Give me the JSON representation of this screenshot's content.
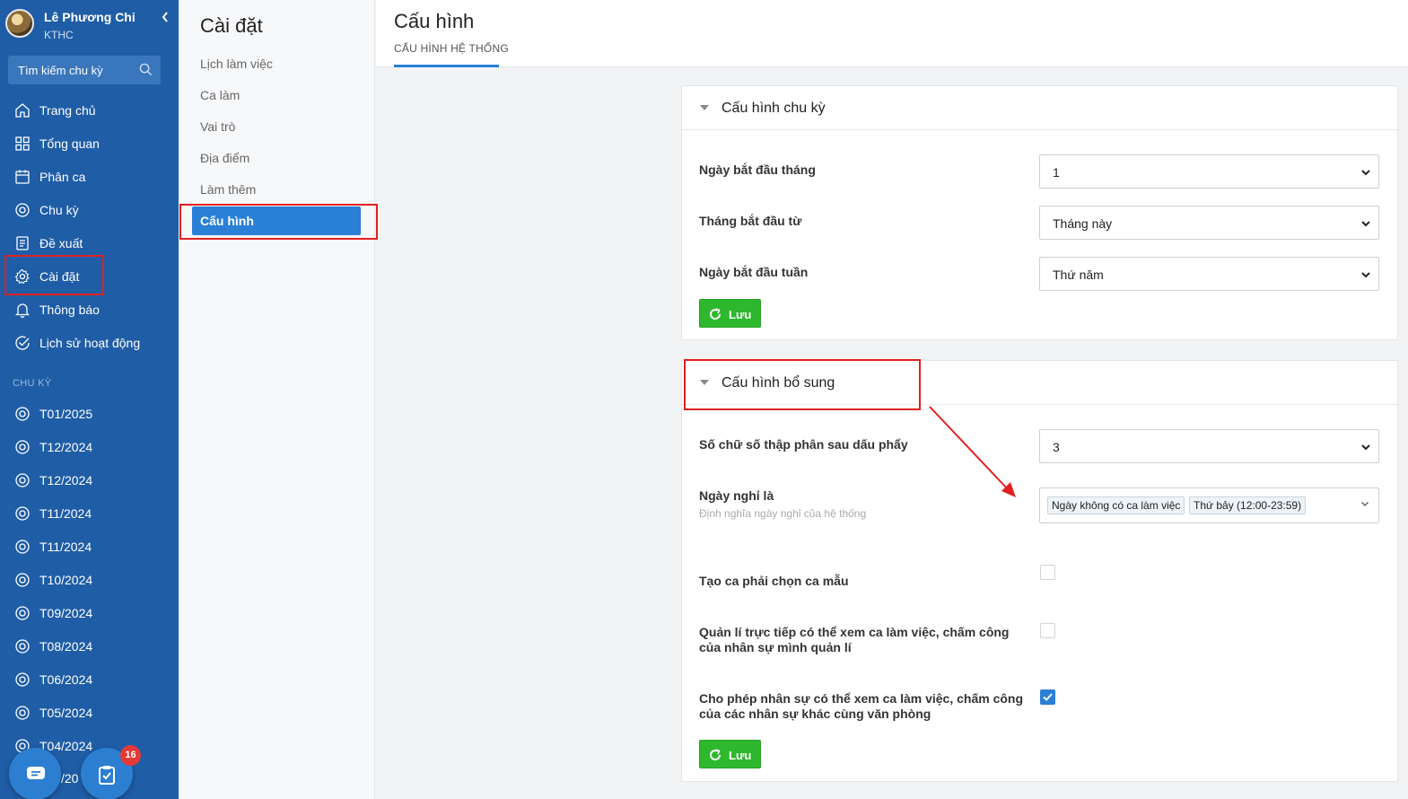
{
  "user": {
    "name": "Lê Phương Chi",
    "role": "KTHC"
  },
  "sidebar": {
    "search_placeholder": "Tìm kiếm chu kỳ",
    "items": [
      {
        "label": "Trang chủ",
        "icon": "home-icon"
      },
      {
        "label": "Tổng quan",
        "icon": "grid-icon"
      },
      {
        "label": "Phân ca",
        "icon": "calendar-icon"
      },
      {
        "label": "Chu kỳ",
        "icon": "cycle-icon"
      },
      {
        "label": "Đề xuất",
        "icon": "document-icon"
      },
      {
        "label": "Cài đặt",
        "icon": "gear-icon"
      },
      {
        "label": "Thông báo",
        "icon": "bell-icon"
      },
      {
        "label": "Lịch sử hoạt động",
        "icon": "check-circle-icon"
      }
    ],
    "section_label": "CHU KỲ",
    "cycles": [
      "T01/2025",
      "T12/2024",
      "T12/2024",
      "T11/2024",
      "T11/2024",
      "T10/2024",
      "T09/2024",
      "T08/2024",
      "T06/2024",
      "T05/2024",
      "T04/2024"
    ],
    "partial_cycle": "/20",
    "notification_count": "16"
  },
  "submenu": {
    "title": "Cài đặt",
    "items": [
      "Lịch làm việc",
      "Ca làm",
      "Vai trò",
      "Địa điểm",
      "Làm thêm"
    ],
    "active": "Cấu hình"
  },
  "header": {
    "title": "Cấu hình",
    "tab": "CẤU HÌNH HỆ THỐNG"
  },
  "cycle_config": {
    "title": "Cấu hình chu kỳ",
    "fields": [
      {
        "label": "Ngày bắt đầu tháng",
        "value": "1"
      },
      {
        "label": "Tháng bắt đầu từ",
        "value": "Tháng này"
      },
      {
        "label": "Ngày bắt đầu tuần",
        "value": "Thứ năm"
      }
    ],
    "save_label": "Lưu"
  },
  "extra_config": {
    "title": "Cấu hình bổ sung",
    "decimal_label": "Số chữ số thập phân sau dấu phẩy",
    "decimal_value": "3",
    "holiday_label": "Ngày nghỉ là",
    "holiday_sub": "Định nghĩa ngày nghỉ của hệ thống",
    "holiday_tags": [
      "Ngày không có ca làm việc",
      "Thứ bảy (12:00-23:59)"
    ],
    "checkboxes": [
      {
        "label": "Tạo ca phải chọn ca mẫu",
        "checked": false
      },
      {
        "label": "Quản lí trực tiếp có thể xem ca làm việc, chấm công của nhân sự mình quản lí",
        "checked": false
      },
      {
        "label": "Cho phép nhân sự có thể xem ca làm việc, chấm công của các nhân sự khác cùng văn phòng",
        "checked": true
      }
    ],
    "save_label": "Lưu"
  },
  "colors": {
    "sidebar": "#1f5da6",
    "accent": "#2a7fd6",
    "save": "#2eb82e",
    "highlight": "#e02020"
  }
}
